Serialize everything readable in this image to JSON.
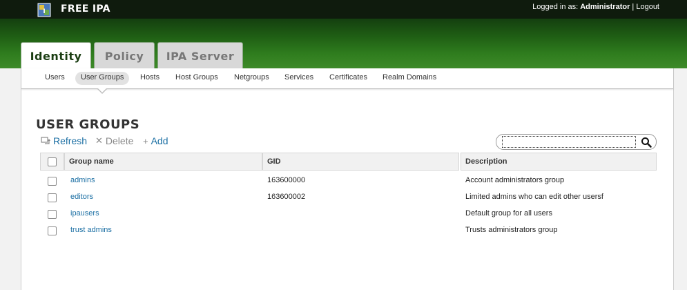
{
  "header": {
    "brand": "FREE IPA",
    "logged_in_label": "Logged in as:",
    "user": "Administrator",
    "separator": "|",
    "logout": "Logout"
  },
  "top_tabs": [
    {
      "label": "Identity",
      "active": true
    },
    {
      "label": "Policy",
      "active": false
    },
    {
      "label": "IPA Server",
      "active": false
    }
  ],
  "subnav": [
    {
      "label": "Users"
    },
    {
      "label": "User Groups",
      "selected": true
    },
    {
      "label": "Hosts"
    },
    {
      "label": "Host Groups"
    },
    {
      "label": "Netgroups"
    },
    {
      "label": "Services"
    },
    {
      "label": "Certificates"
    },
    {
      "label": "Realm Domains"
    }
  ],
  "page": {
    "title": "USER GROUPS"
  },
  "actions": {
    "refresh": "Refresh",
    "delete": "Delete",
    "add": "Add"
  },
  "search": {
    "value": "",
    "placeholder": ""
  },
  "table": {
    "columns": [
      "Group name",
      "GID",
      "Description"
    ],
    "rows": [
      {
        "name": "admins",
        "gid": "163600000",
        "description": "Account administrators group"
      },
      {
        "name": "editors",
        "gid": "163600002",
        "description": "Limited admins who can edit other usersf"
      },
      {
        "name": "ipausers",
        "gid": "",
        "description": "Default group for all users"
      },
      {
        "name": "trust admins",
        "gid": "",
        "description": "Trusts administrators group"
      }
    ]
  },
  "colors": {
    "header_bg": "#0f1b0d",
    "green_band": "#2f7d1e",
    "link": "#1a6ea3",
    "active_tab_text": "#1a3d12"
  },
  "icons": {
    "logo": "freeipa-logo-icon",
    "refresh": "refresh-icon",
    "delete": "delete-icon",
    "add": "add-icon",
    "search": "search-icon"
  }
}
